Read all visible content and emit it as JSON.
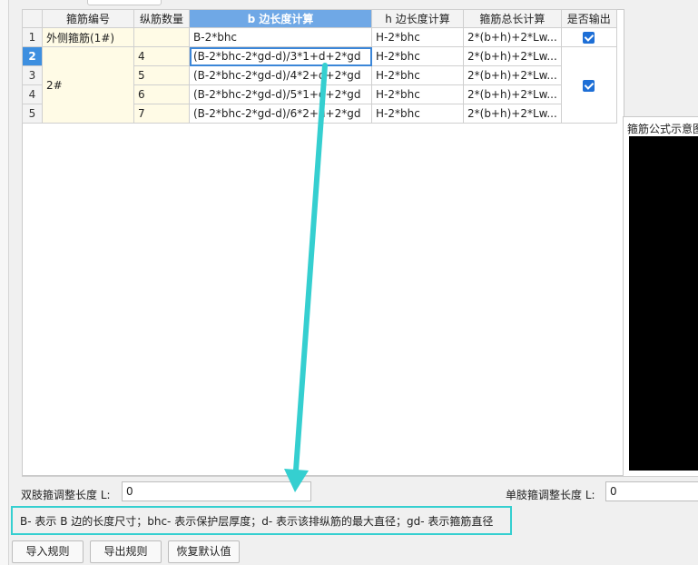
{
  "table": {
    "headers": [
      "",
      "箍筋编号",
      "纵筋数量",
      "b 边长度计算",
      "h 边长度计算",
      "箍筋总长计算",
      "是否输出"
    ],
    "rows": [
      {
        "num": "1",
        "code": "外侧箍筋(1#)",
        "count": "",
        "b": "B-2*bhc",
        "h": "H-2*bhc",
        "total": "2*(b+h)+2*Lw..."
      },
      {
        "num": "2",
        "code": "2#",
        "count": "4",
        "b": "(B-2*bhc-2*gd-d)/3*1+d+2*gd",
        "h": "H-2*bhc",
        "total": "2*(b+h)+2*Lw..."
      },
      {
        "num": "3",
        "count": "5",
        "b": "(B-2*bhc-2*gd-d)/4*2+d+2*gd",
        "h": "H-2*bhc",
        "total": "2*(b+h)+2*Lw..."
      },
      {
        "num": "4",
        "count": "6",
        "b": "(B-2*bhc-2*gd-d)/5*1+d+2*gd",
        "h": "H-2*bhc",
        "total": "2*(b+h)+2*Lw..."
      },
      {
        "num": "5",
        "count": "7",
        "b": "(B-2*bhc-2*gd-d)/6*2+d+2*gd",
        "h": "H-2*bhc",
        "total": "2*(b+h)+2*Lw..."
      }
    ]
  },
  "preview": {
    "title": "箍筋公式示意图"
  },
  "double_adjust": {
    "label": "双肢箍调整长度 L:",
    "value": "0"
  },
  "single_adjust": {
    "label": "单肢箍调整长度 L:",
    "value": "0"
  },
  "legend_text": "B- 表示 B 边的长度尺寸；bhc- 表示保护层厚度；d- 表示该排纵筋的最大直径；gd- 表示箍筋直径",
  "buttons": {
    "import": "导入规则",
    "export": "导出规则",
    "restore": "恢复默认值"
  },
  "colors": {
    "annotation": "#35cfd0",
    "accent": "#3d8fe0",
    "code_cell": "#fffbe6"
  }
}
